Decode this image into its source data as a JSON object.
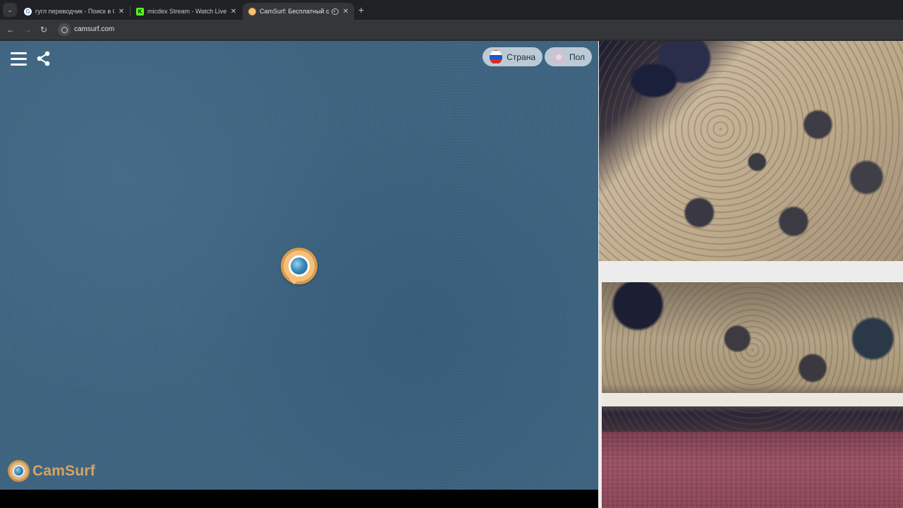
{
  "browser": {
    "tabs": [
      {
        "title": "гугл переводчик - Поиск в Goo",
        "favicon": "google-icon",
        "active": false
      },
      {
        "title": "micdex Stream - Watch Live on",
        "favicon": "kick-icon",
        "active": false
      },
      {
        "title": "CamSurf: Бесплатный случ",
        "favicon": "camsurf-icon",
        "active": true,
        "audio": true
      }
    ],
    "new_tab_label": "+",
    "url": "camsurf.com"
  },
  "app": {
    "filters": {
      "country_label": "Страна",
      "gender_label": "Пол"
    },
    "brand_name": "CamSurf"
  },
  "colors": {
    "accent": "#f3c17c",
    "accent_border": "#d99b4b",
    "video_bg": "#3d6380"
  }
}
